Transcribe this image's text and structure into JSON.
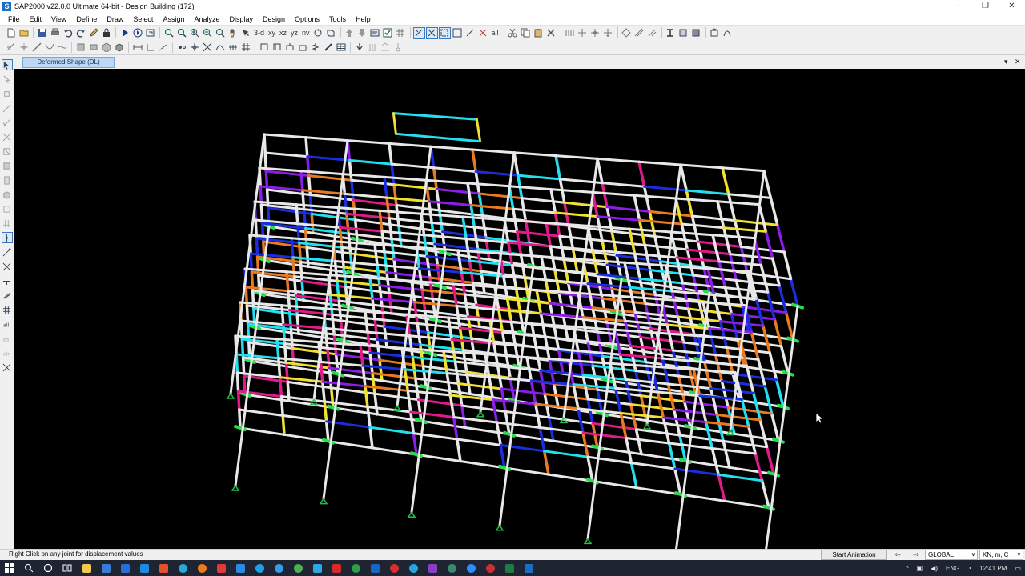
{
  "window": {
    "title": "SAP2000 v22.0.0 Ultimate 64-bit - Design Building (172)",
    "logo": "S",
    "controls": [
      "–",
      "❐",
      "✕"
    ]
  },
  "menu": [
    "File",
    "Edit",
    "View",
    "Define",
    "Draw",
    "Select",
    "Assign",
    "Analyze",
    "Display",
    "Design",
    "Options",
    "Tools",
    "Help"
  ],
  "toolbar": {
    "view_3d": "3-d",
    "view_xy": "xy",
    "view_xz": "xz",
    "view_yz": "yz",
    "view_nv": "nv",
    "all_label": "all"
  },
  "document_tab": {
    "label": "Deformed Shape (DL)",
    "menu_glyph": "▾",
    "close_glyph": "✕"
  },
  "status": {
    "hint": "Right Click on any joint for displacement values",
    "start_animation": "Start Animation",
    "coord_system": "GLOBAL",
    "units": "KN, m, C"
  },
  "taskbar": {
    "language": "ENG",
    "time": "12:41 PM"
  },
  "colors": {
    "viewport_bg": "#000000",
    "beam_white": "#e8e8e8",
    "beam_purple": "#8a1ee6",
    "beam_blue": "#1a2ee0",
    "beam_orange": "#e87a22",
    "beam_green": "#22e04a",
    "beam_cyan": "#22e0f0",
    "beam_magenta": "#e01a8a",
    "beam_yellow": "#f0e030",
    "support_green": "#22c04a"
  }
}
